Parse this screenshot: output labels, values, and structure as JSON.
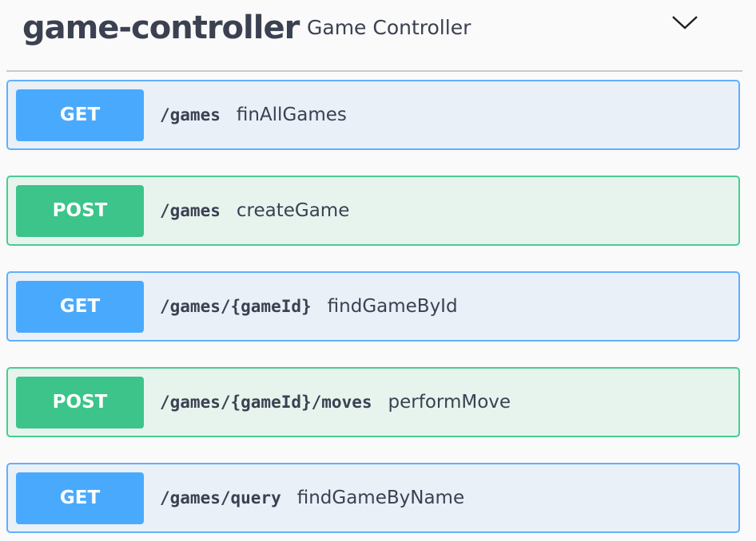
{
  "tag": {
    "name": "game-controller",
    "description": "Game Controller",
    "expand_icon": "chevron-down-icon"
  },
  "operations": [
    {
      "method": "GET",
      "path": "/games",
      "summary": "finAllGames"
    },
    {
      "method": "POST",
      "path": "/games",
      "summary": "createGame"
    },
    {
      "method": "GET",
      "path": "/games/{gameId}",
      "summary": "findGameById"
    },
    {
      "method": "POST",
      "path": "/games/{gameId}/moves",
      "summary": "performMove"
    },
    {
      "method": "GET",
      "path": "/games/query",
      "summary": "findGameByName"
    }
  ],
  "colors": {
    "get_accent": "#61affe",
    "get_bg": "#e9f0f8",
    "post_accent": "#49cc90",
    "post_bg": "#e7f4ee",
    "text": "#3b4151"
  }
}
